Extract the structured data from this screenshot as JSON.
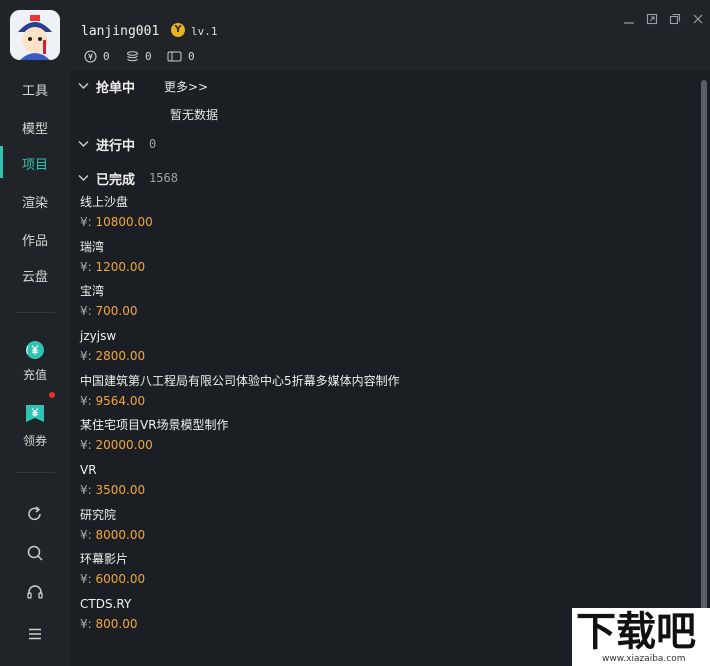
{
  "user": {
    "name": "lanjing001",
    "level": "lv.1",
    "level_badge": "Y"
  },
  "stats": [
    {
      "icon": "yuan-coin-icon",
      "value": "0"
    },
    {
      "icon": "stack-coins-icon",
      "value": "0"
    },
    {
      "icon": "ticket-icon",
      "value": "0"
    }
  ],
  "window_controls": [
    "minimize-icon",
    "restore-icon",
    "maximize-icon",
    "close-icon"
  ],
  "sidebar": {
    "items": [
      {
        "label": "工具",
        "active": false
      },
      {
        "label": "模型",
        "active": false
      },
      {
        "label": "项目",
        "active": true
      },
      {
        "label": "渲染",
        "active": false
      },
      {
        "label": "作品",
        "active": false
      },
      {
        "label": "云盘",
        "active": false
      }
    ],
    "recharge": {
      "label": "充值",
      "icon": "recharge-icon"
    },
    "coupon": {
      "label": "领券",
      "icon": "coupon-icon"
    },
    "tools": [
      "refresh-icon",
      "search-icon",
      "headset-icon",
      "menu-icon"
    ]
  },
  "sections": {
    "grabbing": {
      "title": "抢单中",
      "more": "更多>>",
      "empty": "暂无数据"
    },
    "in_progress": {
      "title": "进行中",
      "count": "0"
    },
    "completed": {
      "title": "已完成",
      "count": "1568"
    }
  },
  "currency_label": "¥:",
  "projects": [
    {
      "name": "线上沙盘",
      "price": "10800.00"
    },
    {
      "name": "瑞湾",
      "price": "1200.00"
    },
    {
      "name": "宝湾",
      "price": "700.00"
    },
    {
      "name": "jzyjsw",
      "price": "2800.00"
    },
    {
      "name": "中国建筑第八工程局有限公司体验中心5折幕多媒体内容制作",
      "price": "9564.00"
    },
    {
      "name": "某住宅项目VR场景模型制作",
      "price": "20000.00"
    },
    {
      "name": "VR",
      "price": "3500.00"
    },
    {
      "name": "研究院",
      "price": "8000.00"
    },
    {
      "name": "环幕影片",
      "price": "6000.00"
    },
    {
      "name": "CTDS.RY",
      "price": "800.00"
    }
  ],
  "watermark": {
    "main": "下载吧",
    "sub": "www.xiazaiba.com"
  },
  "colors": {
    "accent": "#2fc3b3",
    "price": "#f2a641",
    "background": "#1b1e22",
    "panel": "#202327"
  }
}
